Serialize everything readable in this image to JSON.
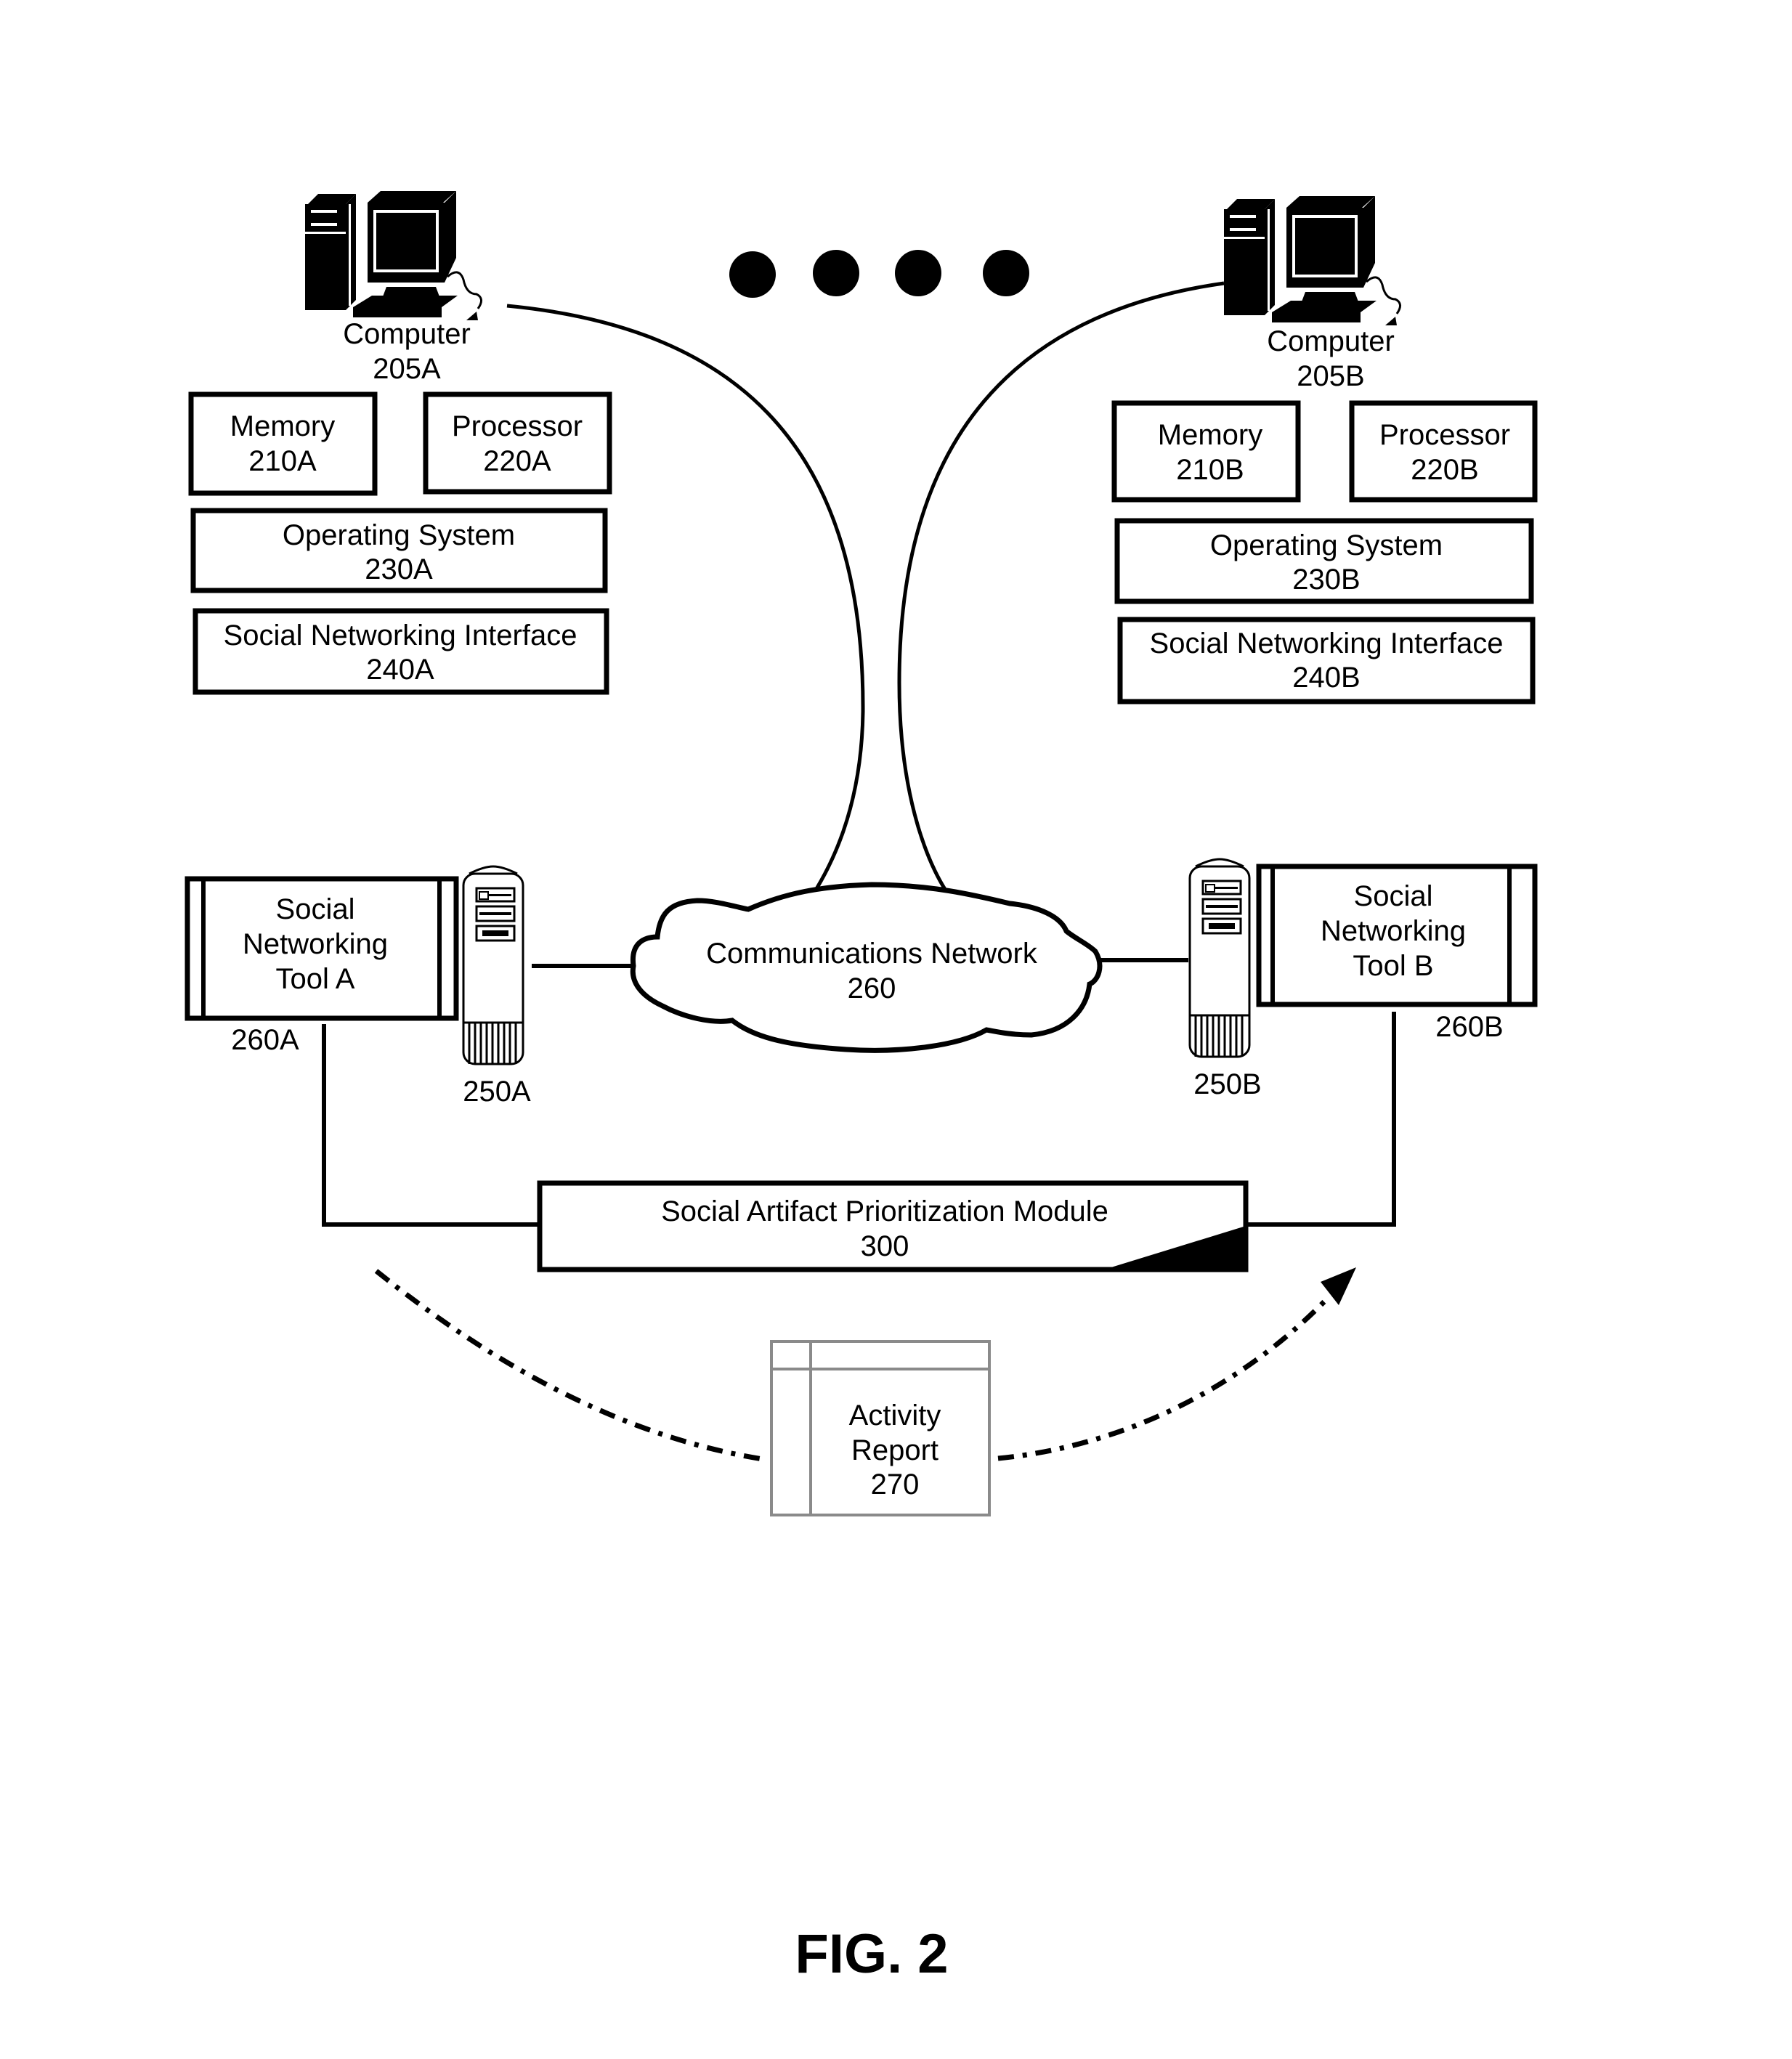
{
  "figure_label": "FIG. 2",
  "computers": [
    {
      "id": "a",
      "label": "Computer",
      "ref": "205A",
      "memory": {
        "label": "Memory",
        "ref": "210A"
      },
      "processor": {
        "label": "Processor",
        "ref": "220A"
      },
      "os": {
        "label": "Operating System",
        "ref": "230A"
      },
      "sni": {
        "label": "Social Networking Interface",
        "ref": "240A"
      }
    },
    {
      "id": "b",
      "label": "Computer",
      "ref": "205B",
      "memory": {
        "label": "Memory",
        "ref": "210B"
      },
      "processor": {
        "label": "Processor",
        "ref": "220B"
      },
      "os": {
        "label": "Operating System",
        "ref": "230B"
      },
      "sni": {
        "label": "Social Networking Interface",
        "ref": "240B"
      }
    }
  ],
  "ellipsis_dots": 4,
  "network": {
    "label": "Communications Network",
    "ref": "260"
  },
  "tools": [
    {
      "line1": "Social",
      "line2": "Networking",
      "line3": "Tool A",
      "ref": "260A"
    },
    {
      "line1": "Social",
      "line2": "Networking",
      "line3": "Tool B",
      "ref": "260B"
    }
  ],
  "servers": [
    {
      "ref": "250A"
    },
    {
      "ref": "250B"
    }
  ],
  "module": {
    "label": "Social Artifact Prioritization Module",
    "ref": "300"
  },
  "report": {
    "line1": "Activity",
    "line2": "Report",
    "line3": "270"
  }
}
